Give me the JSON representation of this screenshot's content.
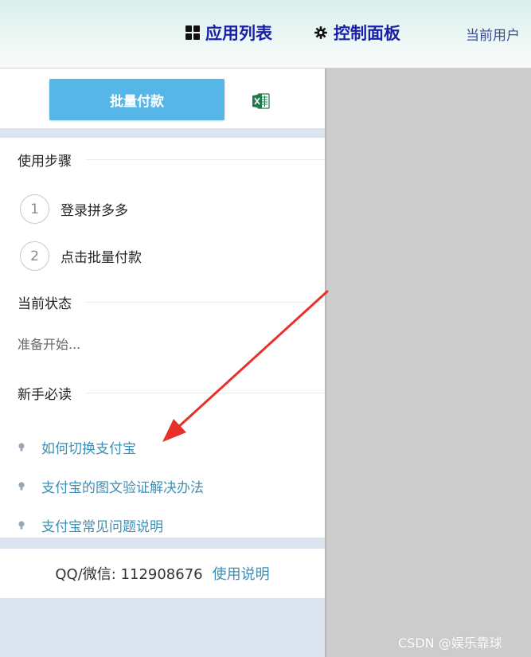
{
  "header": {
    "nav": [
      {
        "label": "应用列表",
        "icon": "grid-icon"
      },
      {
        "label": "控制面板",
        "icon": "gear-icon"
      }
    ],
    "current_user": "当前用户"
  },
  "toolbar": {
    "batch_pay_label": "批量付款",
    "excel_icon": "excel-icon"
  },
  "steps_section": {
    "title": "使用步骤",
    "steps": [
      {
        "number": "1",
        "label": "登录拼多多"
      },
      {
        "number": "2",
        "label": "点击批量付款"
      }
    ]
  },
  "status_section": {
    "title": "当前状态",
    "text": "准备开始..."
  },
  "guide_section": {
    "title": "新手必读",
    "items": [
      {
        "label": "如何切换支付宝",
        "icon": "bulb-icon"
      },
      {
        "label": "支付宝的图文验证解决办法",
        "icon": "bulb-icon"
      },
      {
        "label": "支付宝常见问题说明",
        "icon": "bulb-icon"
      }
    ]
  },
  "footer": {
    "contact": "QQ/微信: 112908676",
    "usage_link": "使用说明"
  },
  "watermark": "CSDN @娱乐靠球",
  "colors": {
    "accent_button": "#56b6e8",
    "nav_text": "#1a1fa8",
    "link": "#3b8fb5",
    "arrow": "#e8302a"
  }
}
